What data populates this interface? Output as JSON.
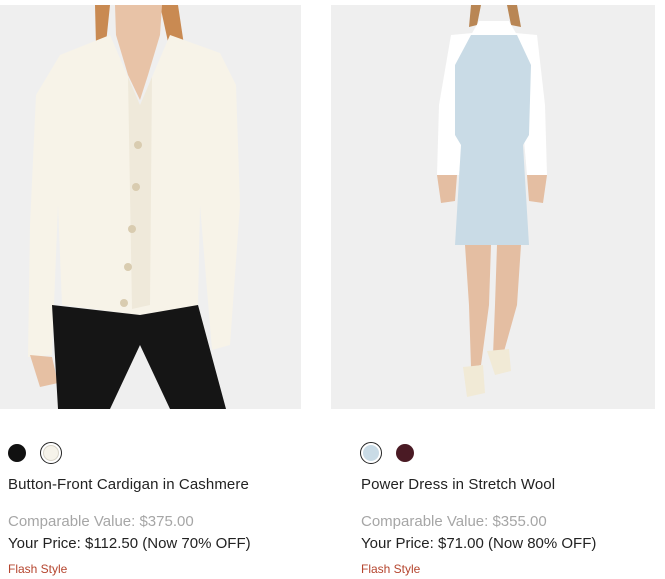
{
  "products": [
    {
      "name": "Button-Front Cardigan in Cashmere",
      "comparable_value": "Comparable Value: $375.00",
      "your_price": "Your Price: $112.50 (Now 70% OFF)",
      "tag": "Flash Style",
      "swatches": [
        {
          "color": "#111111",
          "selected": false
        },
        {
          "color": "#f6f3ea",
          "selected": true
        }
      ],
      "image_icon": "cardigan-photo"
    },
    {
      "name": "Power Dress in Stretch Wool",
      "comparable_value": "Comparable Value: $355.00",
      "your_price": "Your Price: $71.00 (Now 80% OFF)",
      "tag": "Flash Style",
      "swatches": [
        {
          "color": "#c9dbe6",
          "selected": true
        },
        {
          "color": "#4a1a24",
          "selected": false
        }
      ],
      "image_icon": "dress-photo"
    }
  ],
  "colors": {
    "tag": "#b5452e",
    "muted": "#a6a6a6",
    "text": "#222222",
    "image_bg": "#efefef"
  }
}
